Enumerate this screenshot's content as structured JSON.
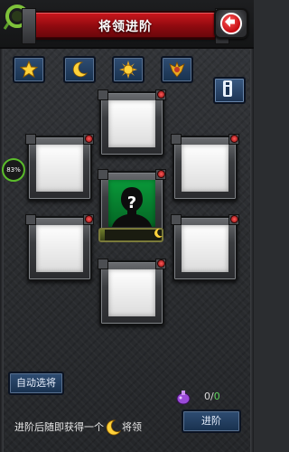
{
  "header": {
    "title": "将领进阶",
    "back_icon": "back-arrow-icon"
  },
  "filters": [
    {
      "name": "star-filter",
      "icon": "star-icon"
    },
    {
      "name": "moon-filter",
      "icon": "moon-icon"
    },
    {
      "name": "sun-filter",
      "icon": "sun-icon"
    },
    {
      "name": "crest-filter",
      "icon": "crest-icon"
    }
  ],
  "side_progress": "83%",
  "center_slot": {
    "icon": "unknown-general-icon",
    "level_fill": 0.08
  },
  "bottom": {
    "auto_select_label": "自动选将",
    "count_current": "0",
    "count_sep": "/",
    "count_required": "0",
    "advance_label": "进阶",
    "hint_before": "进阶后随即获得一个",
    "hint_after": "将领"
  },
  "colors": {
    "title_bar": "#c8161c",
    "button_blue": "#2f4d73",
    "slot_dot": "#ff5c5c",
    "unknown_bg": "#0a9a3a"
  }
}
